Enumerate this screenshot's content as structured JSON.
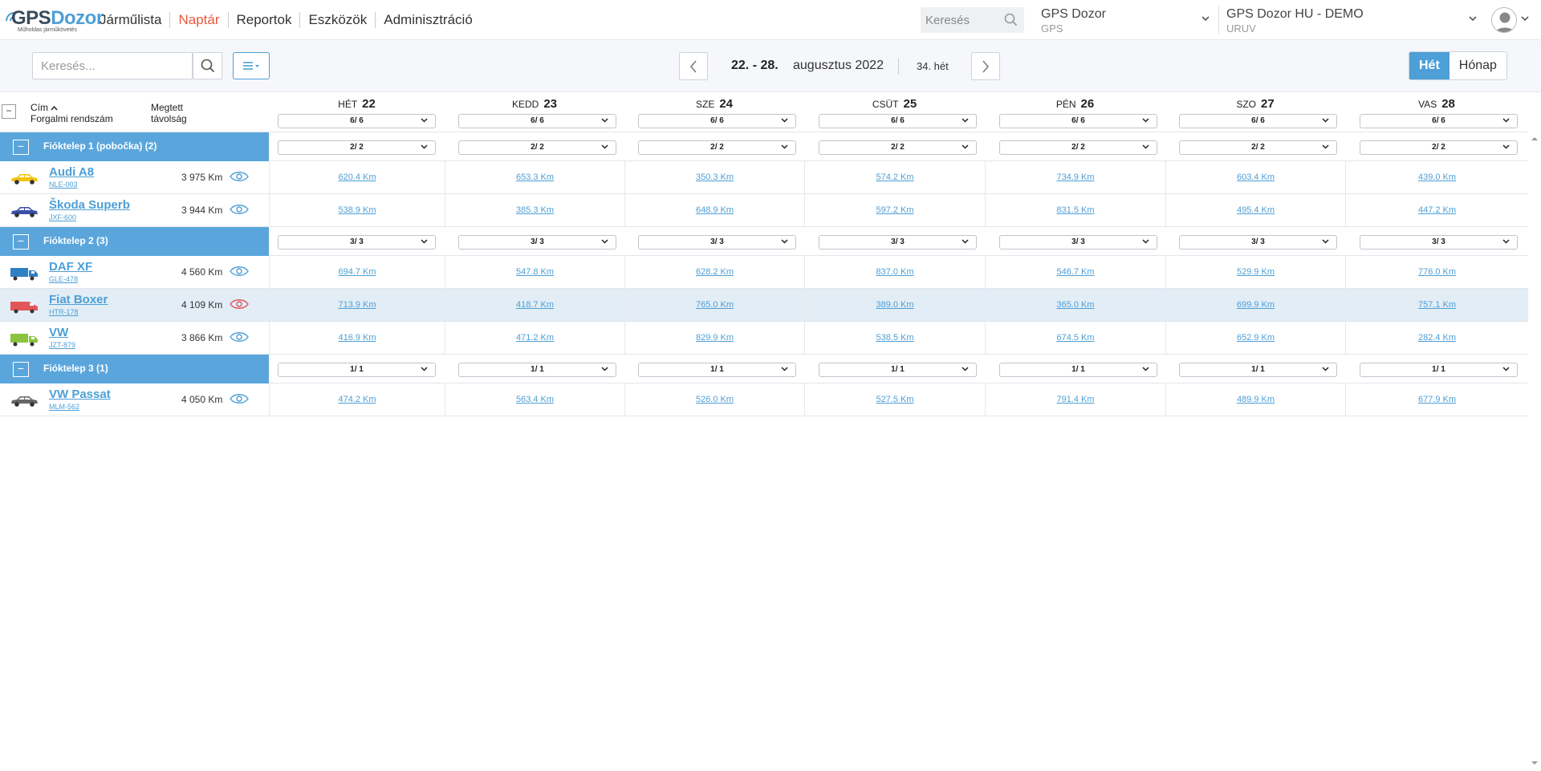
{
  "brand": {
    "name_part1": "GPS",
    "name_part2": "Dozor",
    "tagline": "Műholdas járműkövetés"
  },
  "nav": [
    {
      "label": "Járműlista",
      "active": false
    },
    {
      "label": "Naptár",
      "active": true
    },
    {
      "label": "Reportok",
      "active": false
    },
    {
      "label": "Eszközök",
      "active": false
    },
    {
      "label": "Adminisztráció",
      "active": false
    }
  ],
  "top_search": {
    "placeholder": "Keresés"
  },
  "org1": {
    "title": "GPS Dozor",
    "subtitle": "GPS"
  },
  "org2": {
    "title": "GPS Dozor HU - DEMO",
    "subtitle": "URUV"
  },
  "toolbar": {
    "search_placeholder": "Keresés...",
    "date_range": "22. - 28.",
    "month_year": "augusztus 2022",
    "week": "34. hét",
    "view_week": "Hét",
    "view_month": "Hónap"
  },
  "columns": {
    "title_line1": "Cím",
    "title_line2": "Forgalmi rendszám",
    "dist_line1": "Megtett",
    "dist_line2": "távolság",
    "collapse_all": "−"
  },
  "days": [
    {
      "name": "HÉT",
      "num": "22",
      "filter": "6/ 6"
    },
    {
      "name": "KEDD",
      "num": "23",
      "filter": "6/ 6"
    },
    {
      "name": "SZE",
      "num": "24",
      "filter": "6/ 6"
    },
    {
      "name": "CSÜT",
      "num": "25",
      "filter": "6/ 6"
    },
    {
      "name": "PÉN",
      "num": "26",
      "filter": "6/ 6"
    },
    {
      "name": "SZO",
      "num": "27",
      "filter": "6/ 6"
    },
    {
      "name": "VAS",
      "num": "28",
      "filter": "6/ 6"
    }
  ],
  "groups": [
    {
      "title": "Fióktelep 1 (pobočka) (2)",
      "toggle": "−",
      "filter": "2/ 2",
      "vehicles": [
        {
          "name": "Audi A8",
          "plate": "NLE-003",
          "distance": "3 975 Km",
          "icon": "car-yellow-icon",
          "color": "#f1c40f",
          "type": "car",
          "eye": "normal",
          "values": [
            "620.4 Km",
            "653.3 Km",
            "350.3 Km",
            "574.2 Km",
            "734.9 Km",
            "603.4 Km",
            "439.0 Km"
          ]
        },
        {
          "name": "Škoda Superb",
          "plate": "JXF-600",
          "distance": "3 944 Km",
          "icon": "car-blue-icon",
          "color": "#3c4fa8",
          "type": "car",
          "eye": "normal",
          "values": [
            "538.9 Km",
            "385.3 Km",
            "648.9 Km",
            "597.2 Km",
            "831.5 Km",
            "495.4 Km",
            "447.2 Km"
          ]
        }
      ]
    },
    {
      "title": "Fióktelep 2 (3)",
      "toggle": "−",
      "filter": "3/ 3",
      "vehicles": [
        {
          "name": "DAF XF",
          "plate": "GLE-478",
          "distance": "4 560 Km",
          "icon": "truck-blue-icon",
          "color": "#2f7fc4",
          "type": "truck",
          "eye": "normal",
          "values": [
            "694.7 Km",
            "547.8 Km",
            "628.2 Km",
            "837.0 Km",
            "546.7 Km",
            "529.9 Km",
            "776.0 Km"
          ]
        },
        {
          "name": "Fiat Boxer",
          "plate": "HTR-178",
          "distance": "4 109 Km",
          "icon": "van-red-icon",
          "color": "#e2565a",
          "type": "van",
          "eye": "red",
          "highlight": true,
          "values": [
            "713.9 Km",
            "418.7 Km",
            "765.0 Km",
            "389.0 Km",
            "365.0 Km",
            "699.9 Km",
            "757.1 Km"
          ]
        },
        {
          "name": "VW",
          "plate": "JZT-879",
          "distance": "3 866 Km",
          "icon": "truck-green-icon",
          "color": "#8ac43f",
          "type": "truck",
          "eye": "normal",
          "values": [
            "416.9 Km",
            "471.2 Km",
            "829.9 Km",
            "538.5 Km",
            "674.5 Km",
            "652.9 Km",
            "282.4 Km"
          ]
        }
      ]
    },
    {
      "title": "Fióktelep 3 (1)",
      "toggle": "−",
      "filter": "1/ 1",
      "vehicles": [
        {
          "name": "VW Passat",
          "plate": "MLM-562",
          "distance": "4 050 Km",
          "icon": "car-gray-icon",
          "color": "#666666",
          "type": "car",
          "eye": "normal",
          "values": [
            "474.2 Km",
            "563.4 Km",
            "526.0 Km",
            "527.5 Km",
            "791.4 Km",
            "489.9 Km",
            "677.9 Km"
          ]
        }
      ]
    }
  ],
  "colors": {
    "accent": "#4d9fd6",
    "group_bg": "#5aa6dc",
    "active_nav": "#e8563f",
    "highlight_row": "#e2edf6",
    "eye_alert": "#e2565a"
  }
}
